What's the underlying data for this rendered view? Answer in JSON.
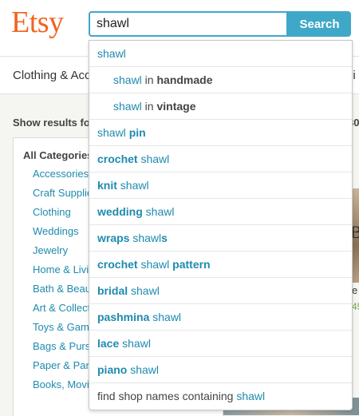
{
  "header": {
    "logo": "Etsy",
    "search_value": "shawl",
    "search_button": "Search"
  },
  "catnav": {
    "first_item": "Clothing & Acce",
    "edge_fragment": "di"
  },
  "sidebar": {
    "show_results": "Show results fo",
    "count_fragment": "30",
    "all_categories": "All Categories",
    "categories": [
      "Accessories",
      "Craft Supplie",
      "Clothing",
      "Weddings",
      "Jewelry",
      "Home & Livi",
      "Bath & Beau",
      "Art & Collect",
      "Toys & Gam",
      "Bags & Purs",
      "Paper & Par",
      "Books, Movi"
    ]
  },
  "result_fragment": {
    "image_text": "B",
    "caption": "e",
    "price": "45"
  },
  "suggestions": [
    {
      "pre": "",
      "pre_bold": "",
      "mid": "shawl",
      "post_bold": "",
      "suffix": "",
      "suffix_bold": "",
      "indent": false
    },
    {
      "pre": "",
      "pre_bold": "",
      "mid": "shawl",
      "post_bold": "",
      "suffix": " in ",
      "suffix_bold": "handmade",
      "indent": true
    },
    {
      "pre": "",
      "pre_bold": "",
      "mid": "shawl",
      "post_bold": "",
      "suffix": " in ",
      "suffix_bold": "vintage",
      "indent": true
    },
    {
      "pre": "",
      "pre_bold": "",
      "mid": "shawl ",
      "post_bold": "pin",
      "suffix": "",
      "suffix_bold": "",
      "indent": false
    },
    {
      "pre": "",
      "pre_bold": "crochet ",
      "mid": "shawl",
      "post_bold": "",
      "suffix": "",
      "suffix_bold": "",
      "indent": false
    },
    {
      "pre": "",
      "pre_bold": "knit ",
      "mid": "shawl",
      "post_bold": "",
      "suffix": "",
      "suffix_bold": "",
      "indent": false
    },
    {
      "pre": "",
      "pre_bold": "wedding ",
      "mid": "shawl",
      "post_bold": "",
      "suffix": "",
      "suffix_bold": "",
      "indent": false
    },
    {
      "pre": "",
      "pre_bold": "wraps ",
      "mid": "shawl",
      "post_bold": "s",
      "suffix": "",
      "suffix_bold": "",
      "indent": false
    },
    {
      "pre": "",
      "pre_bold": "crochet ",
      "mid": "shawl ",
      "post_bold": "pattern",
      "suffix": "",
      "suffix_bold": "",
      "indent": false
    },
    {
      "pre": "",
      "pre_bold": "bridal ",
      "mid": "shawl",
      "post_bold": "",
      "suffix": "",
      "suffix_bold": "",
      "indent": false
    },
    {
      "pre": "",
      "pre_bold": "pashmina ",
      "mid": "shawl",
      "post_bold": "",
      "suffix": "",
      "suffix_bold": "",
      "indent": false
    },
    {
      "pre": "",
      "pre_bold": "lace ",
      "mid": "shawl",
      "post_bold": "",
      "suffix": "",
      "suffix_bold": "",
      "indent": false
    },
    {
      "pre": "",
      "pre_bold": "piano ",
      "mid": "shawl",
      "post_bold": "",
      "suffix": "",
      "suffix_bold": "",
      "indent": false
    },
    {
      "pre": "find shop names containing ",
      "pre_bold": "",
      "mid": "shawl",
      "post_bold": "",
      "suffix": "",
      "suffix_bold": "",
      "indent": false
    }
  ],
  "colors": {
    "brand": "#f1641e",
    "accent": "#3fa8c8",
    "link": "#1f8aaf"
  }
}
